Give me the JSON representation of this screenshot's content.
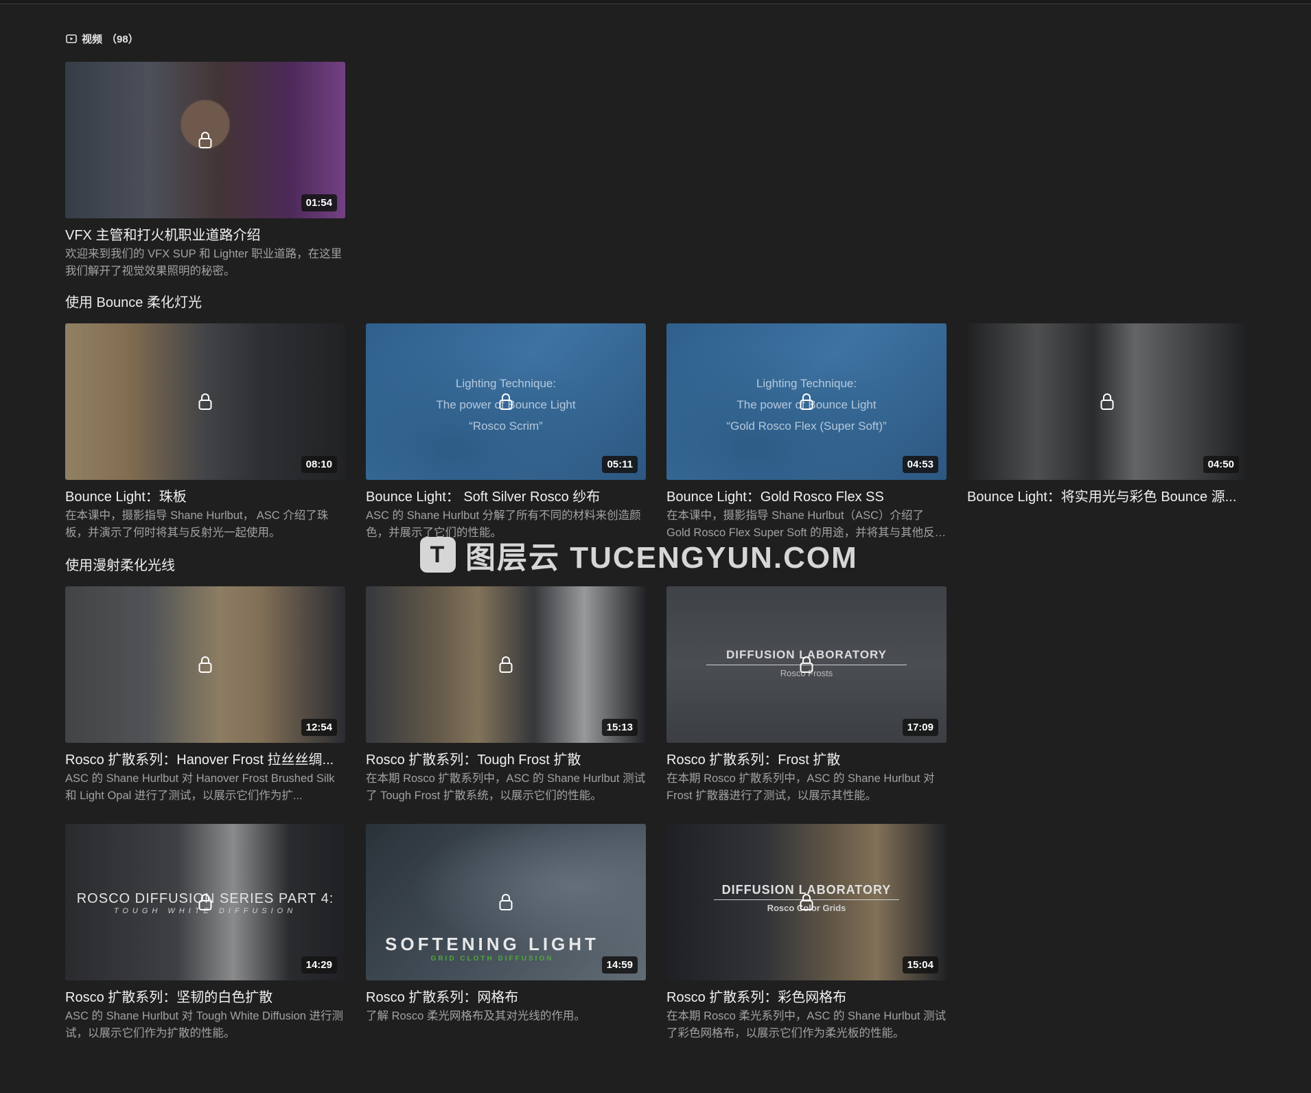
{
  "header": {
    "icon": "video-icon",
    "label": "视频",
    "count": "（98）"
  },
  "featured": {
    "title": "VFX 主管和打火机职业道路介绍",
    "desc": "欢迎来到我们的 VFX SUP 和 Lighter 职业道路，在这里我们解开了视觉效果照明的秘密。",
    "duration": "01:54"
  },
  "sections": [
    {
      "title": "使用 Bounce 柔化灯光",
      "cards": [
        {
          "title": "Bounce Light：珠板",
          "desc": "在本课中，摄影指导 Shane Hurlbut， ASC 介绍了珠板，并演示了何时将其与反射光一起使用。",
          "duration": "08:10"
        },
        {
          "title": "Bounce Light： Soft Silver Rosco 纱布",
          "desc": "ASC 的 Shane Hurlbut 分解了所有不同的材料来创造颜色，并展示了它们的性能。",
          "duration": "05:11",
          "overlay": [
            "Lighting Technique:",
            "The power of Bounce Light",
            "“Rosco Scrim”"
          ]
        },
        {
          "title": "Bounce Light：Gold Rosco Flex SS",
          "desc": "在本课中，摄影指导 Shane Hurlbut（ASC）介绍了 Gold Rosco Flex Super Soft 的用途，并将其与其他反射器进行了比较，并轨...",
          "duration": "04:53",
          "overlay": [
            "Lighting Technique:",
            "The power of Bounce Light",
            "“Gold Rosco Flex (Super Soft)”"
          ]
        },
        {
          "title": "Bounce Light：将实用光与彩色 Bounce 源...",
          "desc": "",
          "duration": "04:50"
        }
      ]
    },
    {
      "title": "使用漫射柔化光线",
      "cards": [
        {
          "title": "Rosco 扩散系列：Hanover Frost 拉丝丝绸...",
          "desc": "ASC 的 Shane Hurlbut 对 Hanover Frost Brushed Silk 和 Light Opal 进行了测试，以展示它们作为扩...",
          "duration": "12:54"
        },
        {
          "title": "Rosco 扩散系列：Tough Frost 扩散",
          "desc": "在本期 Rosco 扩散系列中，ASC 的 Shane Hurlbut 测试了 Tough Frost 扩散系统，以展示它们的性能。",
          "duration": "15:13"
        },
        {
          "title": "Rosco 扩散系列：Frost 扩散",
          "desc": "在本期 Rosco 扩散系列中，ASC 的 Shane Hurlbut 对 Frost 扩散器进行了测试，以展示其性能。",
          "duration": "17:09",
          "overlay": [
            "DIFFUSION LABORATORY",
            "Rosco Frosts"
          ]
        },
        {
          "title": "Rosco 扩散系列：坚韧的白色扩散",
          "desc": "ASC 的 Shane Hurlbut 对 Tough White Diffusion 进行测试，以展示它们作为扩散的性能。",
          "duration": "14:29",
          "overlay": [
            "ROSCO DIFFUSION SERIES PART 4:",
            "TOUGH WHITE DIFFUSION"
          ]
        },
        {
          "title": "Rosco 扩散系列：网格布",
          "desc": "了解 Rosco 柔光网格布及其对光线的作用。",
          "duration": "14:59",
          "overlay": [
            "SOFTENING LIGHT",
            "GRID CLOTH DIFFUSION"
          ]
        },
        {
          "title": "Rosco 扩散系列：彩色网格布",
          "desc": "在本期 Rosco 柔光系列中，ASC 的 Shane Hurlbut 测试了彩色网格布，以展示它们作为柔光板的性能。",
          "duration": "15:04",
          "overlay": [
            "DIFFUSION LABORATORY",
            "Rosco Color Grids"
          ]
        }
      ]
    }
  ],
  "watermark": {
    "badge": "T",
    "text": "图层云  TUCENGYUN.COM"
  }
}
